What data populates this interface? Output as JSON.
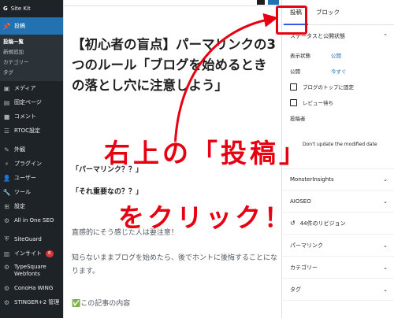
{
  "sidebar": {
    "site_title": "Site Kit",
    "active_item": "投稿",
    "sub_items": [
      "投稿一覧",
      "新規追加",
      "カテゴリー",
      "タグ"
    ],
    "items": [
      "メディア",
      "固定ページ",
      "コメント",
      "RTOC設定"
    ],
    "items2": [
      "外観",
      "プラグイン",
      "ユーザー",
      "ツール",
      "設定",
      "All in One SEO"
    ],
    "items3_siteguard": "SiteGuard",
    "items3_insight": "インサイト",
    "insight_badge": "6",
    "items3_typesquare": "TypeSquare Webfonts",
    "items3_conoha": "ConoHa WING",
    "items3_stinger": "STINGER+2 管理"
  },
  "editor": {
    "title": "【初心者の盲点】パーマリンクの3つのルール「ブログを始めるときの落とし穴に注意しよう」",
    "heading1": "「パーマリンク？？」",
    "heading2": "「それ重要なの？？」",
    "para1": "直感的にそう感じた人は要注意！",
    "para2": "知らないままブログを始めたら、後でホントに後悔することになります。",
    "para3": "✅この記事の内容"
  },
  "panel": {
    "tab_post": "投稿",
    "tab_block": "ブロック",
    "status_section": "ステータスと公開状態",
    "visibility_label": "表示状態",
    "visibility_value": "公開",
    "publish_label": "公開",
    "publish_value": "今すぐ",
    "sticky_label": "ブログのトップに固定",
    "review_label": "レビュー待ち",
    "author_label": "投稿者",
    "modified_fragment": "Don't update the modified date",
    "monsterinsights": "MonsterInsights",
    "aioseo": "AIOSEO",
    "revisions": "44件のリビジョン",
    "permalink": "パーマリンク",
    "category": "カテゴリー",
    "tag": "タグ"
  },
  "annotation": {
    "line1": "右上の「投稿」",
    "line2": "をクリック！",
    "color": "#e60012"
  }
}
